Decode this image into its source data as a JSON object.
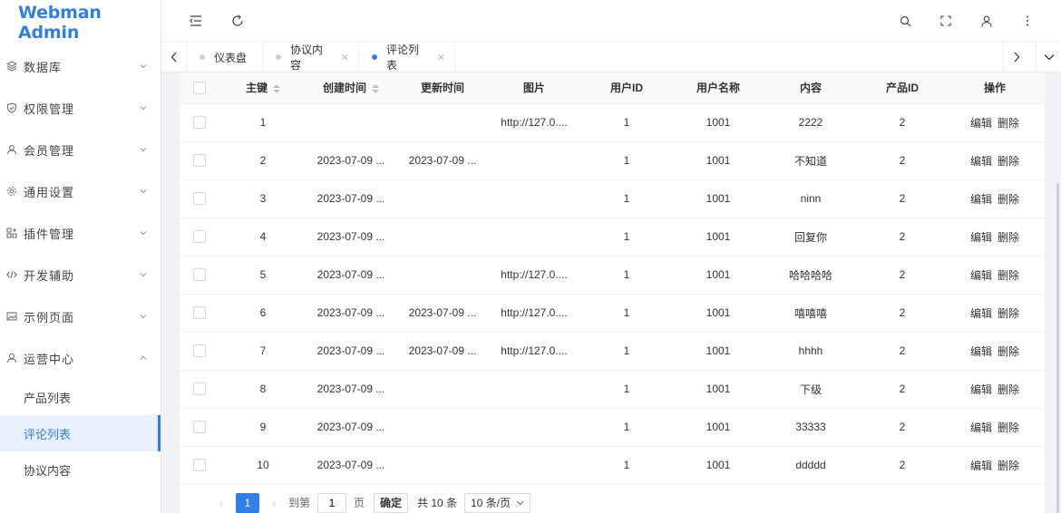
{
  "app": {
    "title": "Webman Admin"
  },
  "sidebar": {
    "items": [
      {
        "label": "数据库",
        "icon": "database-icon",
        "expanded": false
      },
      {
        "label": "权限管理",
        "icon": "shield-icon",
        "expanded": false
      },
      {
        "label": "会员管理",
        "icon": "user-icon",
        "expanded": false
      },
      {
        "label": "通用设置",
        "icon": "gear-icon",
        "expanded": false
      },
      {
        "label": "插件管理",
        "icon": "plugin-icon",
        "expanded": false
      },
      {
        "label": "开发辅助",
        "icon": "code-icon",
        "expanded": false
      },
      {
        "label": "示例页面",
        "icon": "picture-icon",
        "expanded": false
      },
      {
        "label": "运营中心",
        "icon": "user-icon",
        "expanded": true
      }
    ],
    "subitems": [
      {
        "label": "产品列表",
        "active": false
      },
      {
        "label": "评论列表",
        "active": true
      },
      {
        "label": "协议内容",
        "active": false
      }
    ]
  },
  "tabs": [
    {
      "label": "仪表盘",
      "closable": false,
      "active": false
    },
    {
      "label": "协议内容",
      "closable": true,
      "active": false
    },
    {
      "label": "评论列表",
      "closable": true,
      "active": true
    }
  ],
  "table": {
    "columns": [
      "主键",
      "创建时间",
      "更新时间",
      "图片",
      "用户ID",
      "用户名称",
      "内容",
      "产品ID",
      "操作"
    ],
    "rows": [
      {
        "id": "1",
        "created": "",
        "updated": "",
        "image": "http://127.0....",
        "user_id": "1",
        "user_name": "1001",
        "content": "2222",
        "product_id": "2"
      },
      {
        "id": "2",
        "created": "2023-07-09 ...",
        "updated": "2023-07-09 ...",
        "image": "",
        "user_id": "1",
        "user_name": "1001",
        "content": "不知道",
        "product_id": "2"
      },
      {
        "id": "3",
        "created": "2023-07-09 ...",
        "updated": "",
        "image": "",
        "user_id": "1",
        "user_name": "1001",
        "content": "ninn",
        "product_id": "2"
      },
      {
        "id": "4",
        "created": "2023-07-09 ...",
        "updated": "",
        "image": "",
        "user_id": "1",
        "user_name": "1001",
        "content": "回复你",
        "product_id": "2"
      },
      {
        "id": "5",
        "created": "2023-07-09 ...",
        "updated": "",
        "image": "http://127.0....",
        "user_id": "1",
        "user_name": "1001",
        "content": "哈哈哈哈",
        "product_id": "2"
      },
      {
        "id": "6",
        "created": "2023-07-09 ...",
        "updated": "2023-07-09 ...",
        "image": "http://127.0....",
        "user_id": "1",
        "user_name": "1001",
        "content": "嘻嘻嘻",
        "product_id": "2"
      },
      {
        "id": "7",
        "created": "2023-07-09 ...",
        "updated": "2023-07-09 ...",
        "image": "http://127.0....",
        "user_id": "1",
        "user_name": "1001",
        "content": "hhhh",
        "product_id": "2"
      },
      {
        "id": "8",
        "created": "2023-07-09 ...",
        "updated": "",
        "image": "",
        "user_id": "1",
        "user_name": "1001",
        "content": "下级",
        "product_id": "2"
      },
      {
        "id": "9",
        "created": "2023-07-09 ...",
        "updated": "",
        "image": "",
        "user_id": "1",
        "user_name": "1001",
        "content": "33333",
        "product_id": "2"
      },
      {
        "id": "10",
        "created": "2023-07-09 ...",
        "updated": "",
        "image": "",
        "user_id": "1",
        "user_name": "1001",
        "content": "ddddd",
        "product_id": "2"
      }
    ],
    "edit_label": "编辑",
    "delete_label": "删除"
  },
  "pagination": {
    "current_page": "1",
    "goto_label": "到第",
    "goto_value": "1",
    "page_unit": "页",
    "confirm_label": "确定",
    "total_label": "共 10 条",
    "page_size": "10 条/页"
  }
}
